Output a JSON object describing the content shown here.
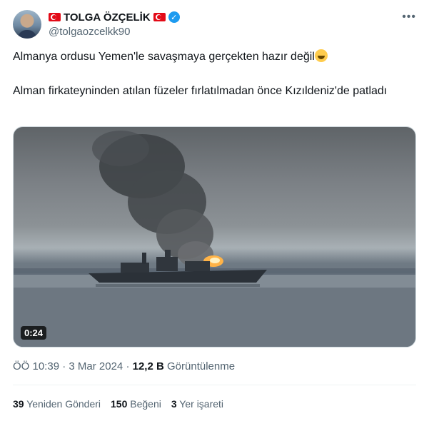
{
  "author": {
    "name": "TOLGA ÖZÇELİK",
    "handle": "@tolgaozcelkk90",
    "verified_icon": "verified-badge-icon",
    "flag_icon": "turkey-flag-icon"
  },
  "tweet": {
    "line1": "Almanya ordusu Yemen'le savaşmaya gerçekten hazır değil",
    "line1_emoji": "rolling-on-floor-laughing-emoji",
    "line2": "Alman firkateyninden atılan füzeler fırlatılmadan önce Kızıldeniz'de patladı"
  },
  "media": {
    "duration": "0:24"
  },
  "meta": {
    "time": "ÖÖ 10:39",
    "sep": "·",
    "date": "3 Mar 2024",
    "views_count": "12,2 B",
    "views_label": "Görüntülenme"
  },
  "stats": {
    "reposts_count": "39",
    "reposts_label": "Yeniden Gönderi",
    "likes_count": "150",
    "likes_label": "Beğeni",
    "bookmarks_count": "3",
    "bookmarks_label": "Yer işareti"
  },
  "colors": {
    "accent": "#1d9bf0",
    "secondary_text": "#536471"
  }
}
